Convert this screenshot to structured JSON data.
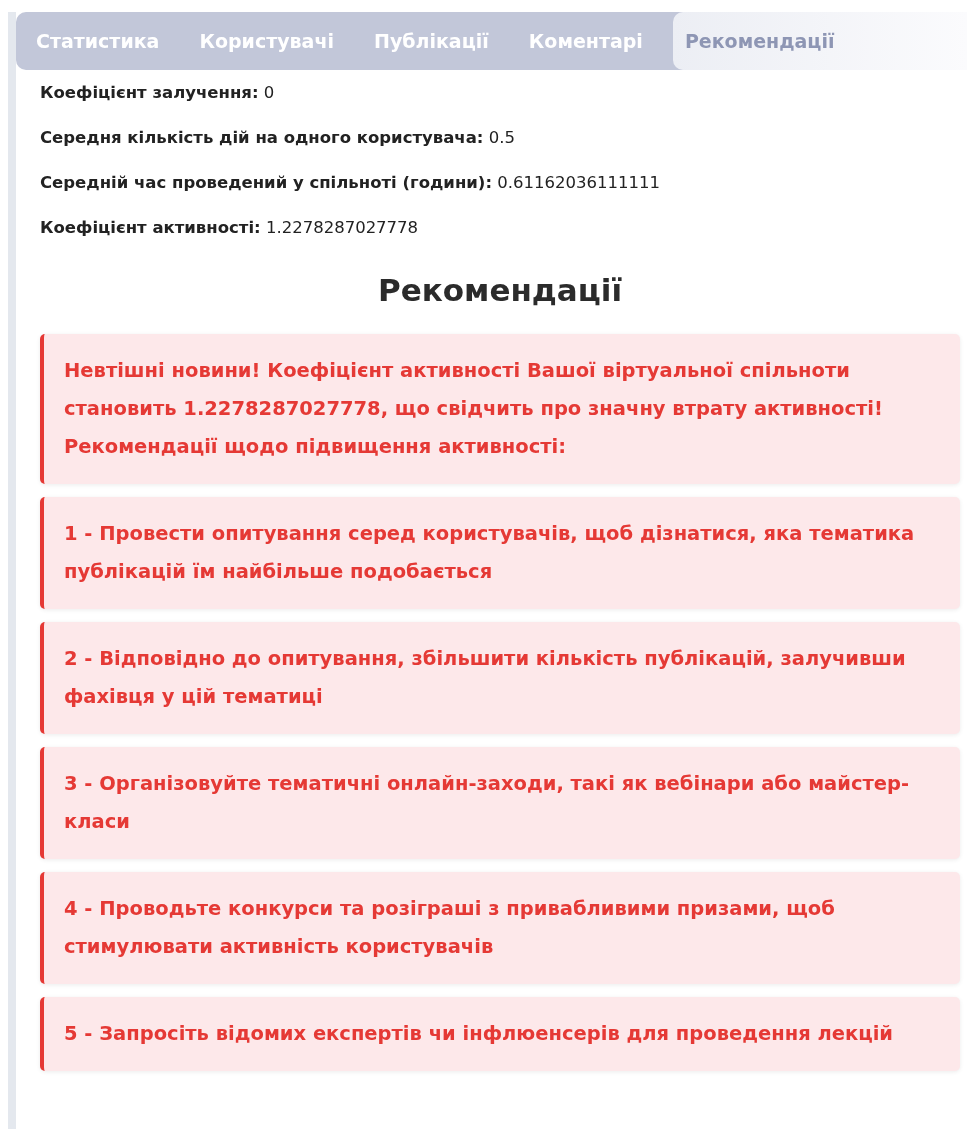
{
  "tabs": [
    {
      "label": "Статистика",
      "selected": false
    },
    {
      "label": "Користувачі",
      "selected": false
    },
    {
      "label": "Публікації",
      "selected": false
    },
    {
      "label": "Коментарі",
      "selected": false
    },
    {
      "label": "Рекомендації",
      "selected": true
    }
  ],
  "stats": [
    "**Коефіцієнт залучення:** 0",
    "**Середня кількість дій на одного користувача:** 0.5",
    "**Середній час проведений у спільноті (години):** 0.61162036111111",
    "**Коефіцієнт активності:** 1.2278287027778"
  ],
  "recommendations": {
    "title": "Рекомендації",
    "alerts": [
      "Невтішні новини! Коефіцієнт активності Вашої віртуальної спільноти становить 1.2278287027778, що свідчить про значну втрату активності! Рекомендації щодо підвищення активності:",
      "1 - Провести опитування серед користувачів, щоб дізнатися, яка тематика публікацій їм найбільше подобається",
      "2 - Відповідно до опитування, збільшити кількість публікацій, залучивши фахівця у цій тематиці",
      "3 - Організовуйте тематичні онлайн-заходи, такі як вебінари або майстер-класи",
      "4 - Проводьте конкурси та розіграші з привабливими призами, щоб стимулювати активність користувачів",
      "5 - Запросіть відомих експертів чи інфлюенсерів для проведення лекцій"
    ]
  }
}
